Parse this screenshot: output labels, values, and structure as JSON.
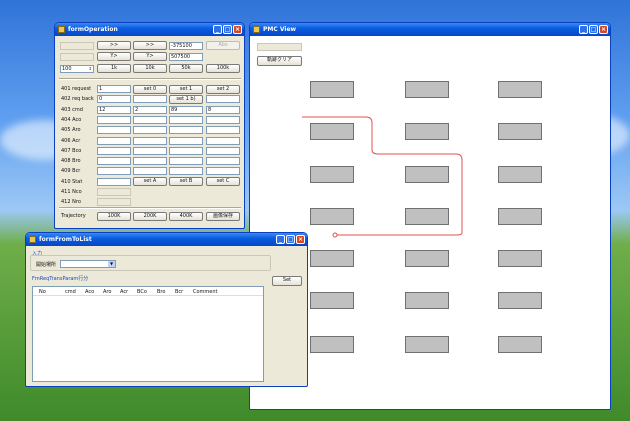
{
  "desktop": {
    "colors": {
      "sky": "#2f73d8",
      "grass": "#3f8a2b"
    }
  },
  "form_operation": {
    "title": "formOperation",
    "top_row1": {
      "btn1": ">>",
      "btn2": ">>",
      "value": "-375100",
      "btn3": "Abs"
    },
    "top_row2": {
      "btn1": "Y>",
      "btn2": "Y>",
      "value": "507500"
    },
    "speed": {
      "value": "100",
      "b1": "1k",
      "b2": "10k",
      "b3": "50k",
      "b4": "100k"
    },
    "rows": [
      {
        "label": "401 request",
        "c1": "1",
        "c2": "set 0",
        "c3": "set 1",
        "c4": "set 2"
      },
      {
        "label": "402 req back",
        "c1": "0",
        "c3": "set 1 b)"
      },
      {
        "label": "403 cmd",
        "c1": "12",
        "c2": "2",
        "c3": "89",
        "c4": "8"
      },
      {
        "label": "404 Aco"
      },
      {
        "label": "405 Aro"
      },
      {
        "label": "406 Acr"
      },
      {
        "label": "407 Bco"
      },
      {
        "label": "408 Bro"
      },
      {
        "label": "409 Bcr"
      },
      {
        "label": "410 Stat",
        "c2": "set A",
        "c3": "set B",
        "c4": "set C"
      },
      {
        "label": "411 Nco"
      },
      {
        "label": "412 Nro"
      }
    ],
    "trajectory": {
      "label": "Trajectory",
      "b1": "100K",
      "b2": "200K",
      "b3": "400K",
      "b4": "画像保存"
    }
  },
  "form_pmc": {
    "title": "PMC View",
    "clear_button": "軌跡クリア",
    "path_color": "#e05050"
  },
  "form_from_to": {
    "title": "formFromToList",
    "group_label": "入力",
    "start_label": "開始場所",
    "table_caption": "FmReqTransParam行分",
    "set_button": "Set",
    "columns": [
      "No",
      "cmd",
      "Aco",
      "Aro",
      "Acr",
      "BCo",
      "Bro",
      "Bcr",
      "Comment"
    ]
  }
}
